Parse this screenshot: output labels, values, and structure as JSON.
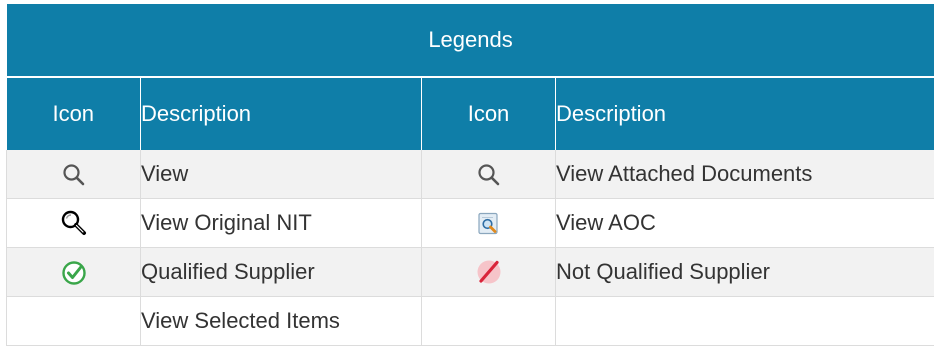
{
  "legend": {
    "title": "Legends",
    "headers": {
      "icon_1": "Icon",
      "description_1": "Description",
      "icon_2": "Icon",
      "description_2": "Description"
    },
    "rows": [
      {
        "left": {
          "icon": "search-icon",
          "label": "View"
        },
        "right": {
          "icon": "search-icon",
          "label": "View Attached Documents"
        }
      },
      {
        "left": {
          "icon": "magnifier-icon",
          "label": "View Original NIT"
        },
        "right": {
          "icon": "document-search-icon",
          "label": "View AOC"
        }
      },
      {
        "left": {
          "icon": "check-circle-icon",
          "label": "Qualified Supplier"
        },
        "right": {
          "icon": "disqualified-icon",
          "label": "Not Qualified Supplier"
        }
      },
      {
        "left": {
          "icon": "",
          "label": "View Selected Items"
        },
        "right": {
          "icon": "",
          "label": ""
        }
      }
    ]
  },
  "colors": {
    "header_background": "#0f7ea8",
    "header_text": "#ffffff",
    "row_shade": "#f2f2f2",
    "qualified_green": "#3aa64a",
    "not_qualified_red": "#d9243a"
  }
}
